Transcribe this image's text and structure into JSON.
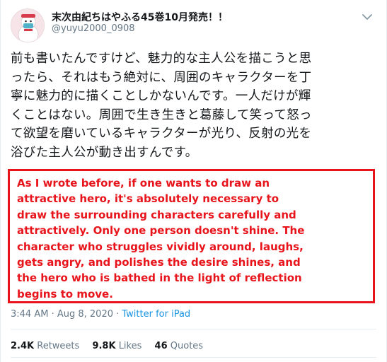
{
  "author": {
    "display_name": "末次由紀ちはやふる45巻10月発売！！",
    "handle": "@yuyu2000_0908"
  },
  "tweet": {
    "lines": [
      "前も書いたんですけど、魅力的な主人公を描こうと思",
      "ったら、それはもう絶対に、周囲のキャラクターを丁",
      "寧に魅力的に描くことしかないんです。一人だけが輝",
      "くことはない。周囲で生き生きと葛藤して笑って怒っ",
      "て欲望を磨いているキャラクターが光り、反射の光を",
      "浴びた主人公が動き出すんです。"
    ]
  },
  "translation": {
    "lines": [
      "As I wrote before, if one wants to draw an",
      "attractive hero, it's absolutely necessary to",
      "draw the surrounding characters carefully and",
      "attractively. Only one person doesn't shine. The",
      "character who struggles vividly around, laughs,",
      "gets angry, and polishes the desire shines, and",
      "the hero who is bathed in the light of reflection",
      "begins to move."
    ],
    "border_color": "#e8141c"
  },
  "meta": {
    "time": "3:44 AM",
    "separator": " · ",
    "date": "Aug 8, 2020",
    "source": "Twitter for iPad"
  },
  "stats": {
    "retweets_count": "2.4K",
    "retweets_label": "Retweets",
    "likes_count": "9.8K",
    "likes_label": "Likes",
    "quotes_count": "46",
    "quotes_label": "Quotes"
  },
  "colors": {
    "text": "#14171a",
    "muted": "#657786",
    "link": "#1b95e0",
    "accent_red": "#e8141c"
  },
  "icons": {
    "caret": "chevron-down-icon",
    "avatar": "snowman-avatar"
  }
}
